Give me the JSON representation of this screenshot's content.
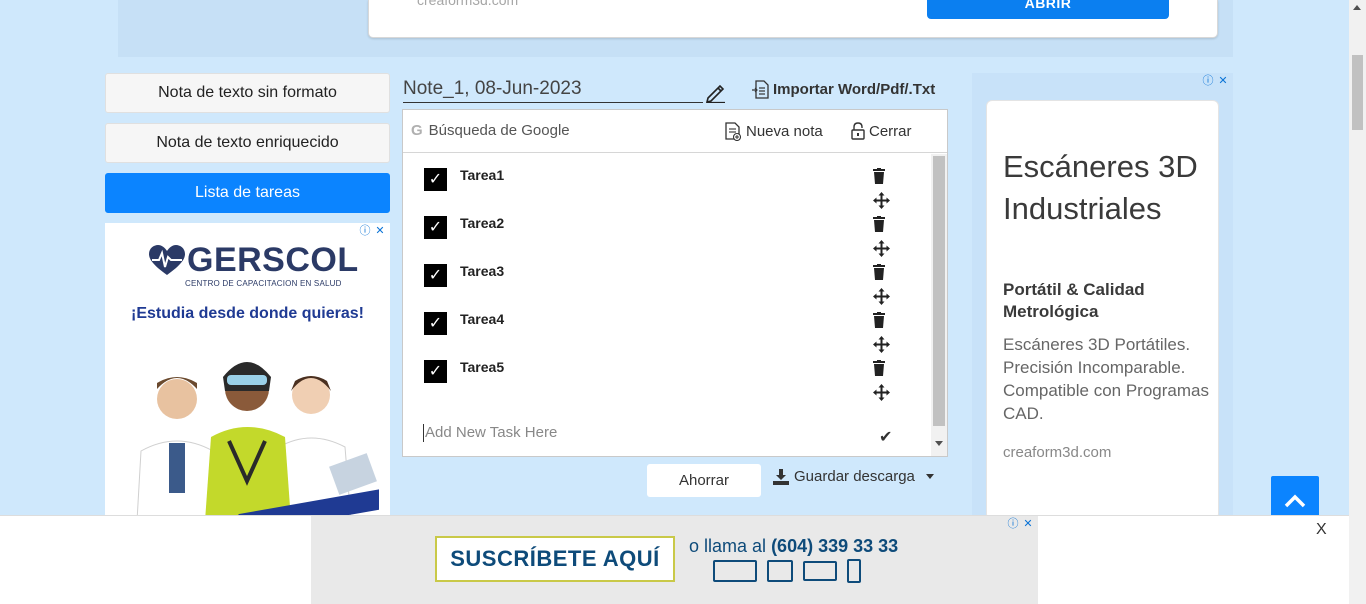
{
  "top_ad": {
    "url": "creaform3d.com",
    "button": "ABRIR"
  },
  "sidebar": {
    "items": [
      {
        "label": "Nota de texto sin formato"
      },
      {
        "label": "Nota de texto enriquecido"
      },
      {
        "label": "Lista de tareas",
        "active": true
      }
    ]
  },
  "left_ad": {
    "brand": "GERSCOL",
    "brand_sub": "CENTRO DE CAPACITACION EN SALUD",
    "tagline": "¡Estudia desde donde quieras!"
  },
  "note": {
    "title": "Note_1, 08-Jun-2023",
    "import_label": "Importar Word/Pdf/.Txt"
  },
  "toolbar": {
    "search_label": "Búsqueda de Google",
    "new_note_label": "Nueva nota",
    "close_label": "Cerrar"
  },
  "tasks": [
    {
      "label": "Tarea1",
      "checked": true
    },
    {
      "label": "Tarea2",
      "checked": true
    },
    {
      "label": "Tarea3",
      "checked": true
    },
    {
      "label": "Tarea4",
      "checked": true
    },
    {
      "label": "Tarea5",
      "checked": true
    }
  ],
  "new_task": {
    "placeholder": "Add New Task Here"
  },
  "actions": {
    "save_label": "Ahorrar",
    "download_label": "Guardar descarga"
  },
  "right_ad": {
    "title": "Escáneres 3D Industriales",
    "subtitle": "Portátil & Calidad Metrológica",
    "description": "Escáneres 3D Portátiles. Precisión Incomparable. Compatible con Programas CAD.",
    "url": "creaform3d.com"
  },
  "bottom_ad": {
    "subscribe": "SUSCRÍBETE AQUÍ",
    "phone_prefix": "o llama al",
    "phone": "(604) 339 33 33",
    "close": "X"
  },
  "colors": {
    "accent": "#0b84ff",
    "page_bg": "#cfe8fc"
  }
}
